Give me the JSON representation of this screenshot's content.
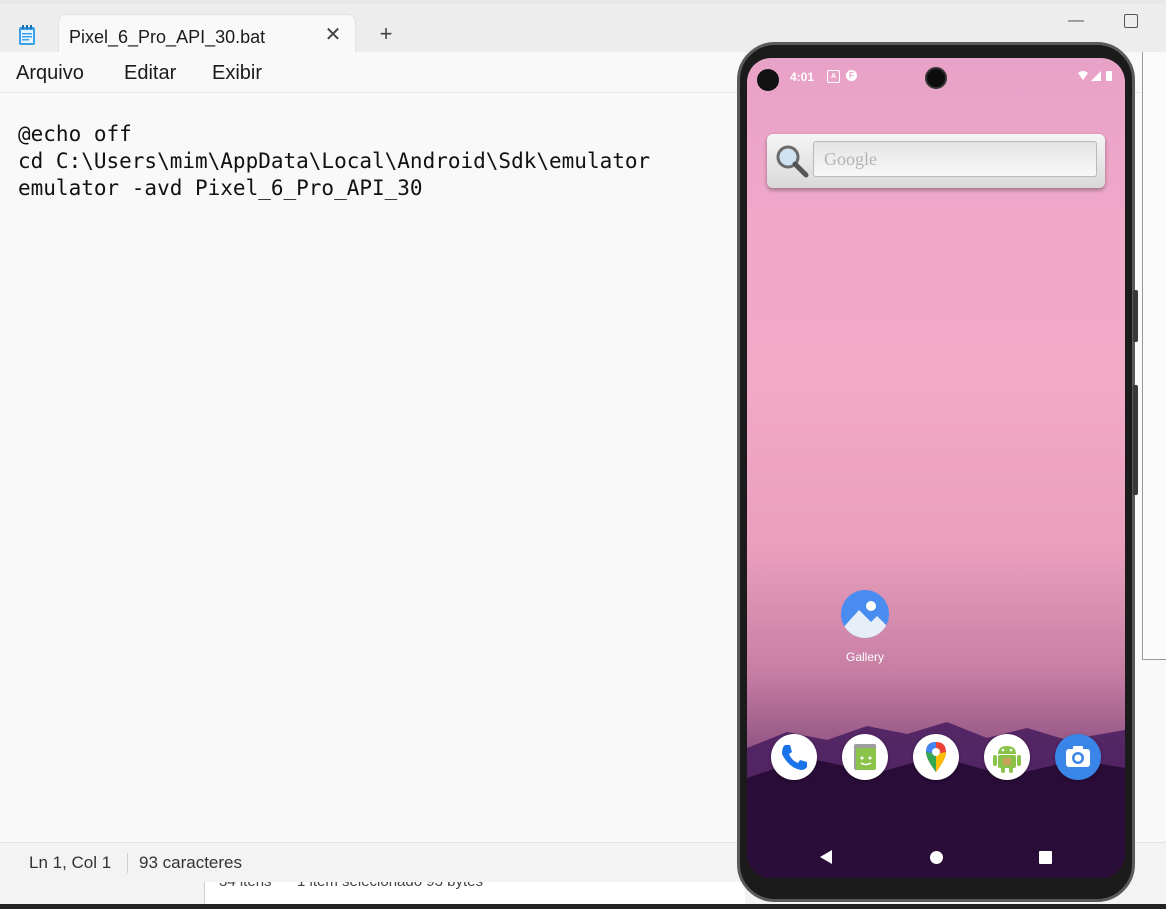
{
  "notepad": {
    "tab_title": "Pixel_6_Pro_API_30.bat",
    "tab_close_glyph": "✕",
    "tab_add_glyph": "+",
    "minimize_glyph": "—",
    "menu": [
      "Arquivo",
      "Editar",
      "Exibir"
    ],
    "content_lines": [
      "@echo off",
      "cd C:\\Users\\mim\\AppData\\Local\\Android\\Sdk\\emulator",
      "emulator -avd Pixel_6_Pro_API_30"
    ],
    "status": {
      "position": "Ln 1, Col 1",
      "char_count": "93 caracteres"
    }
  },
  "background_window": {
    "status_left": "34 itens",
    "status_right": "1 item selecionado  93 bytes"
  },
  "emulator": {
    "status_time": "4:01",
    "search_placeholder": "Google",
    "apps": {
      "gallery_label": "Gallery"
    },
    "dock": [
      "phone-icon",
      "messaging-icon",
      "maps-icon",
      "android-app-icon",
      "camera-icon"
    ],
    "colors": {
      "accent_blue": "#4a8df0",
      "camera_blue": "#3a86e8",
      "android_green": "#8bc34a",
      "phone_blue": "#1a73e8"
    }
  }
}
